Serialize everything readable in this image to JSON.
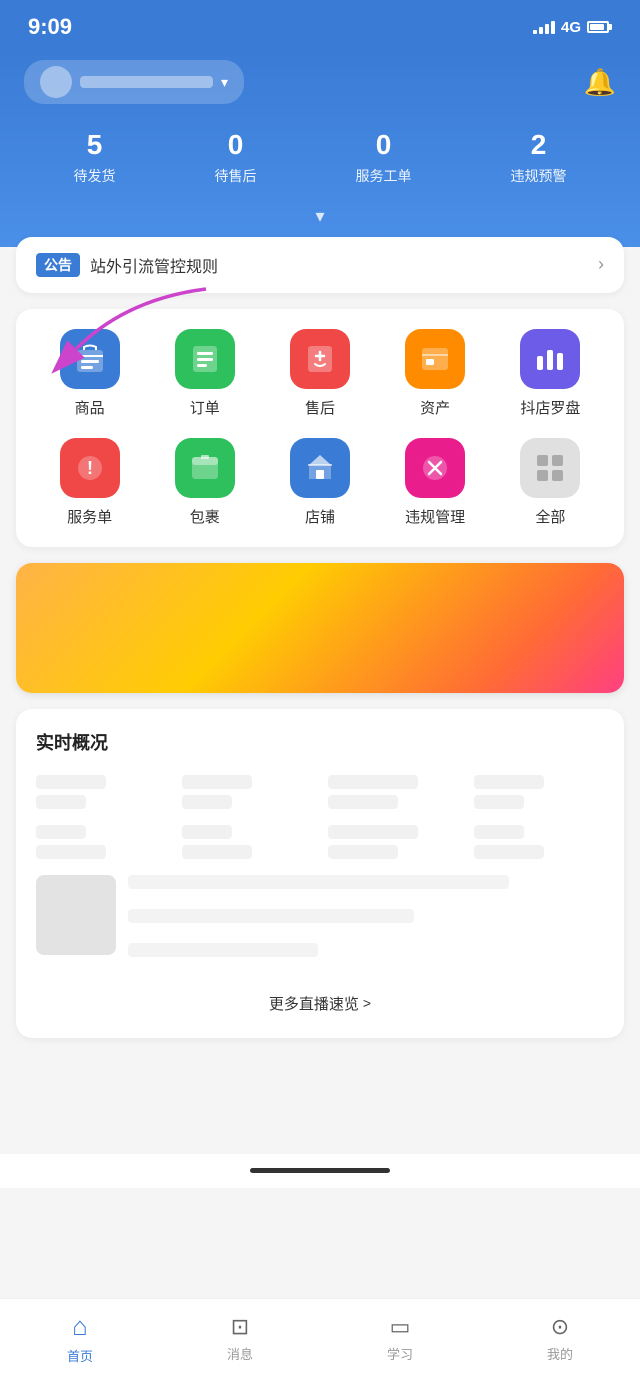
{
  "statusBar": {
    "time": "9:09",
    "network": "4G"
  },
  "header": {
    "storeName": "",
    "bellLabel": "notifications"
  },
  "stats": [
    {
      "number": "5",
      "label": "待发货"
    },
    {
      "number": "0",
      "label": "待售后"
    },
    {
      "number": "0",
      "label": "服务工单"
    },
    {
      "number": "2",
      "label": "违规预警"
    }
  ],
  "announcement": {
    "tag": "公告",
    "text": "站外引流管控规则"
  },
  "menuItems": {
    "row1": [
      {
        "label": "商品",
        "iconColor": "icon-blue"
      },
      {
        "label": "订单",
        "iconColor": "icon-green"
      },
      {
        "label": "售后",
        "iconColor": "icon-pink"
      },
      {
        "label": "资产",
        "iconColor": "icon-orange"
      },
      {
        "label": "抖店罗盘",
        "iconColor": "icon-purple"
      }
    ],
    "row2": [
      {
        "label": "服务单",
        "iconColor": "icon-red"
      },
      {
        "label": "包裹",
        "iconColor": "icon-green2"
      },
      {
        "label": "店铺",
        "iconColor": "icon-blue2"
      },
      {
        "label": "违规管理",
        "iconColor": "icon-pink2"
      },
      {
        "label": "全部",
        "iconColor": "icon-gray"
      }
    ]
  },
  "realtimeSection": {
    "title": "实时概况"
  },
  "moreLink": {
    "text": "更多直播速览",
    "arrow": ">"
  },
  "bottomNav": [
    {
      "label": "首页",
      "active": true,
      "icon": "home"
    },
    {
      "label": "消息",
      "active": false,
      "icon": "message"
    },
    {
      "label": "学习",
      "active": false,
      "icon": "book"
    },
    {
      "label": "我的",
      "active": false,
      "icon": "user"
    }
  ]
}
